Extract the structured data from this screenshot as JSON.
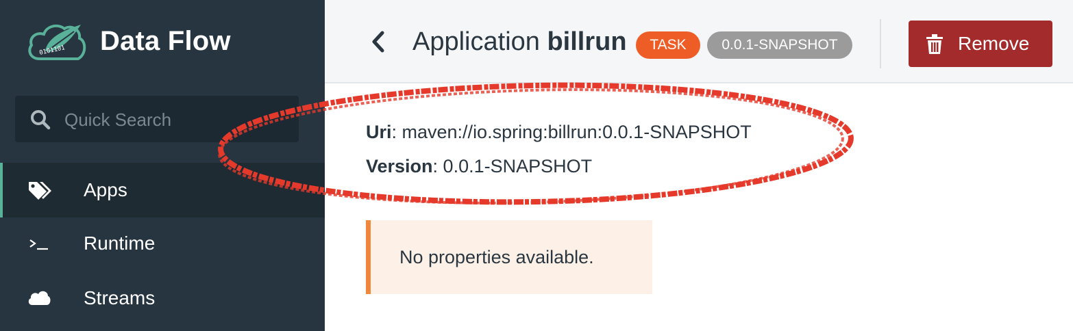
{
  "sidebar": {
    "brand": "Data Flow",
    "logo_text": "0101101",
    "search": {
      "placeholder": "Quick Search",
      "value": ""
    },
    "items": [
      {
        "label": "Apps",
        "icon": "tags-icon",
        "active": true
      },
      {
        "label": "Runtime",
        "icon": "terminal-icon",
        "active": false
      },
      {
        "label": "Streams",
        "icon": "cloud-icon",
        "active": false
      }
    ]
  },
  "header": {
    "title_prefix": "Application",
    "title_name": "billrun",
    "badges": {
      "type": "TASK",
      "version": "0.0.1-SNAPSHOT"
    },
    "remove_label": "Remove"
  },
  "details": {
    "uri_label": "Uri",
    "uri_value": ": maven://io.spring:billrun:0.0.1-SNAPSHOT",
    "version_label": "Version",
    "version_value": ": 0.0.1-SNAPSHOT"
  },
  "notice": {
    "text": "No properties available."
  },
  "colors": {
    "sidebar_bg": "#263540",
    "accent_green": "#5ab199",
    "task_badge": "#ef5d27",
    "version_badge": "#9b9b9b",
    "remove_button": "#a32b2b",
    "annotation_red": "#e53a2b",
    "notice_border": "#f0873a",
    "notice_bg": "#fdf1e7"
  }
}
